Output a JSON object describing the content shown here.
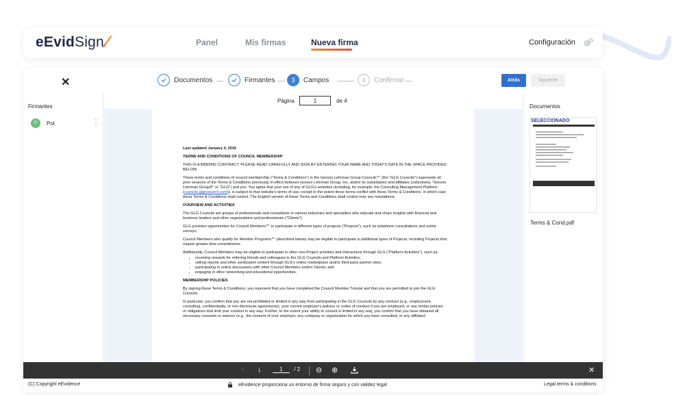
{
  "header": {
    "brand_main": "eEvid",
    "brand_accent": "Sign",
    "nav": [
      {
        "label": "Panel",
        "active": false
      },
      {
        "label": "Mis firmas",
        "active": false
      },
      {
        "label": "Nueva firma",
        "active": true
      }
    ],
    "config_label": "Configuración",
    "config_icon": "gear-icon"
  },
  "wizard": {
    "steps": [
      {
        "number": "",
        "label": "Documentos",
        "state": "done"
      },
      {
        "number": "",
        "label": "Firmantes",
        "state": "done"
      },
      {
        "number": "3",
        "label": "Campos",
        "state": "current"
      },
      {
        "number": "4",
        "label": "Confirmar",
        "state": "pending"
      }
    ],
    "back_label": "Atrás",
    "next_label": "Siguiente"
  },
  "left_panel": {
    "title": "Firmantes",
    "signers": [
      {
        "initial": "P",
        "name": "Pol"
      }
    ]
  },
  "viewer": {
    "page_label": "Página",
    "page_value": "1",
    "page_of": "de 4",
    "doc": {
      "updated": "Last updated January 4, 2016",
      "title": "TERMS AND CONDITIONS OF COUNCIL MEMBERSHIP",
      "p1": "THIS IS A BINDING CONTRACT.  PLEASE READ CAREFULLY AND SIGN BY ENTERING YOUR NAME AND TODAY'S DATE IN THE SPACE PROVIDED BELOW.",
      "p2a": "These terms and conditions of council membership (\"Terms & Conditions\") in the Gerson Lehrman Group Councils℠ (the \"GLG Councils\") supersede all prior versions of the Terms & Conditions previously in effect between Gerson Lehrman Group, Inc. and/or its subsidiaries and affiliates (collectively, \"Gerson Lehrman Group®\" or \"GLG\") and you.  You agree that your use of any of GLG's websites (including, for example, the Consulting Management Platform (",
      "p2link": "councils.glgresearch.com",
      "p2b": ")), is subject to that website's terms of use, except to the extent  those terms conflict with these Terms & Conditions, in which case these Terms & Conditions shall control. The English version of these Terms and Conditions shall control over any translations.",
      "h2": "OVERVIEW AND ACTIVITIES",
      "p3": "The GLG Councils are groups of professionals and consultants in various industries and specialties who educate and share insights with financial and business leaders and other organizations and professionals (\"Clients\").",
      "p4": "GLG provides opportunities for Council Members℠ to participate in different types of projects (\"Projects\"), such as telephone consultations and online surveys.",
      "p5": "Council Members who qualify for Member Programs℠ (described below) may be eligible to participate in additional types of Projects, including Projects that require greater time commitments.",
      "p6": "Additionally, Council Members may be eligible to participate in other non-Project activities and interactions through GLG (\"Platform Activities\"), such as:",
      "bullets": [
        "receiving rewards for referring friends and colleagues to the GLG Councils and Platform Activities;",
        "selling reports and other syndicated content through GLG's online marketplace and/or third party partner sites;",
        "participating in online discussions with other Council Members and/or Clients; and",
        "engaging in other networking and educational opportunities."
      ],
      "h3": "MEMBERSHIP POLICIES",
      "p7": "By signing these Terms & Conditions, you represent that you have completed the Council Member Tutorial and that you are permitted to join the GLG Councils.",
      "p8": "In particular, you confirm that you are not prohibited or limited in any way from participating in the GLG Councils by any contract (e.g., employment, consulting, confidentiality, or non-disclosure agreements), your current employer's policies or codes of conduct if you are employed, or any similar policies or obligations that limit your conduct in any way. Further, to the extent your ability to consult is limited in any way, you confirm that you have obtained all necessary consents or waivers (e.g., the consent of your employer, any company or organization for which you have consulted, or any affiliated"
    }
  },
  "right_panel": {
    "title": "Documentos",
    "badge": "SELECCIONADO",
    "file_name": "Terms & Cond.pdf"
  },
  "toolbar": {
    "page_current": "1",
    "page_total": "/ 2"
  },
  "footer": {
    "copyright": "(C) Copyright eEvidence",
    "center_text": "eEvidence proporciona un entorno de firma seguro y con validez legal",
    "right_text": "Legal terms & conditions"
  },
  "colors": {
    "accent_blue": "#3b82d6",
    "brand_dark": "#1f2a44",
    "underline_orange": "#f08a2d",
    "avatar_green": "#6cc17a"
  }
}
